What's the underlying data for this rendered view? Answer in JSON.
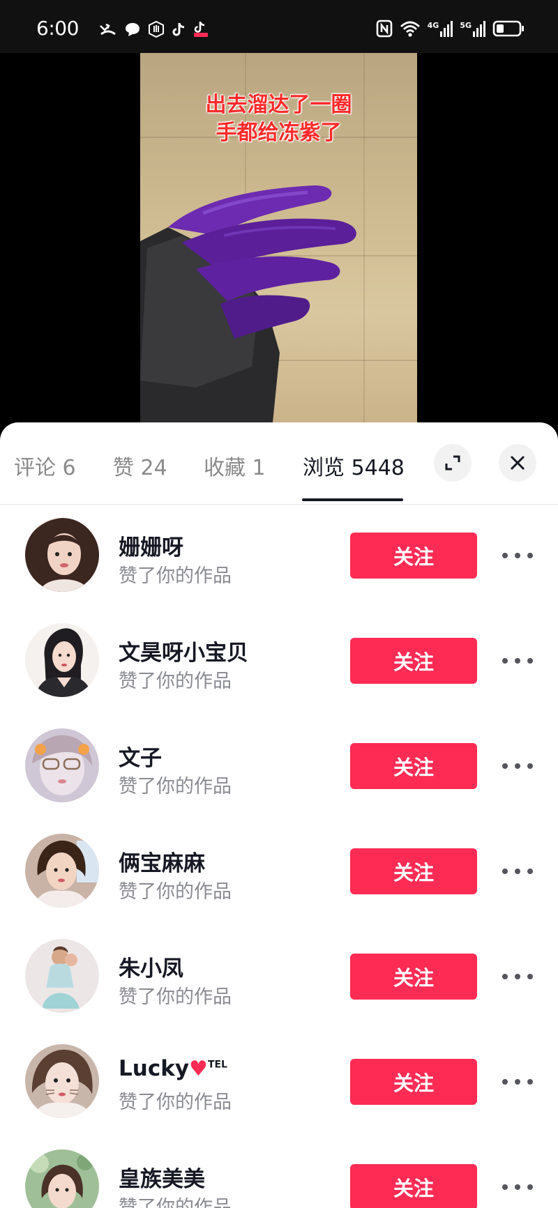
{
  "status_bar": {
    "time": "6:00",
    "left_icons": [
      "missed-call-icon",
      "chat-bubble-icon",
      "hand-icon",
      "tiktok-icon",
      "tiktok-lite-icon"
    ],
    "right_icons": [
      "nfc-icon",
      "wifi-icon",
      "signal-4g-icon",
      "signal-5g-icon",
      "battery-icon"
    ],
    "network_a": "4G",
    "network_b": "5G"
  },
  "video": {
    "caption_line1": "出去溜达了一圈",
    "caption_line2": "手都给冻紫了"
  },
  "tabs": [
    {
      "label": "评论 6",
      "active": false
    },
    {
      "label": "赞 24",
      "active": false
    },
    {
      "label": "收藏 1",
      "active": false
    },
    {
      "label": "浏览 5448",
      "active": true
    }
  ],
  "follow_label": "关注",
  "users": [
    {
      "name": "姗姗呀",
      "subtitle": "赞了你的作品",
      "avatar_color": "#d9c2b7"
    },
    {
      "name": "文昊呀小宝贝",
      "subtitle": "赞了你的作品",
      "avatar_color": "#f1ede9"
    },
    {
      "name": "文子",
      "subtitle": "赞了你的作品",
      "avatar_color": "#cfc6d6"
    },
    {
      "name": "俩宝麻麻",
      "subtitle": "赞了你的作品",
      "avatar_color": "#c8b3a6"
    },
    {
      "name": "朱小凤",
      "subtitle": "赞了你的作品",
      "avatar_color": "#e9e2e2"
    },
    {
      "name": "Lucky",
      "name_suffix": "TEL",
      "subtitle": "赞了你的作品",
      "avatar_color": "#c9b6ab"
    },
    {
      "name": "皇族美美",
      "subtitle": "赞了你的作品",
      "avatar_color": "#9fbf98"
    }
  ],
  "colors": {
    "accent": "#fe2c55",
    "text_primary": "#161823",
    "text_secondary": "#8a8b91"
  }
}
